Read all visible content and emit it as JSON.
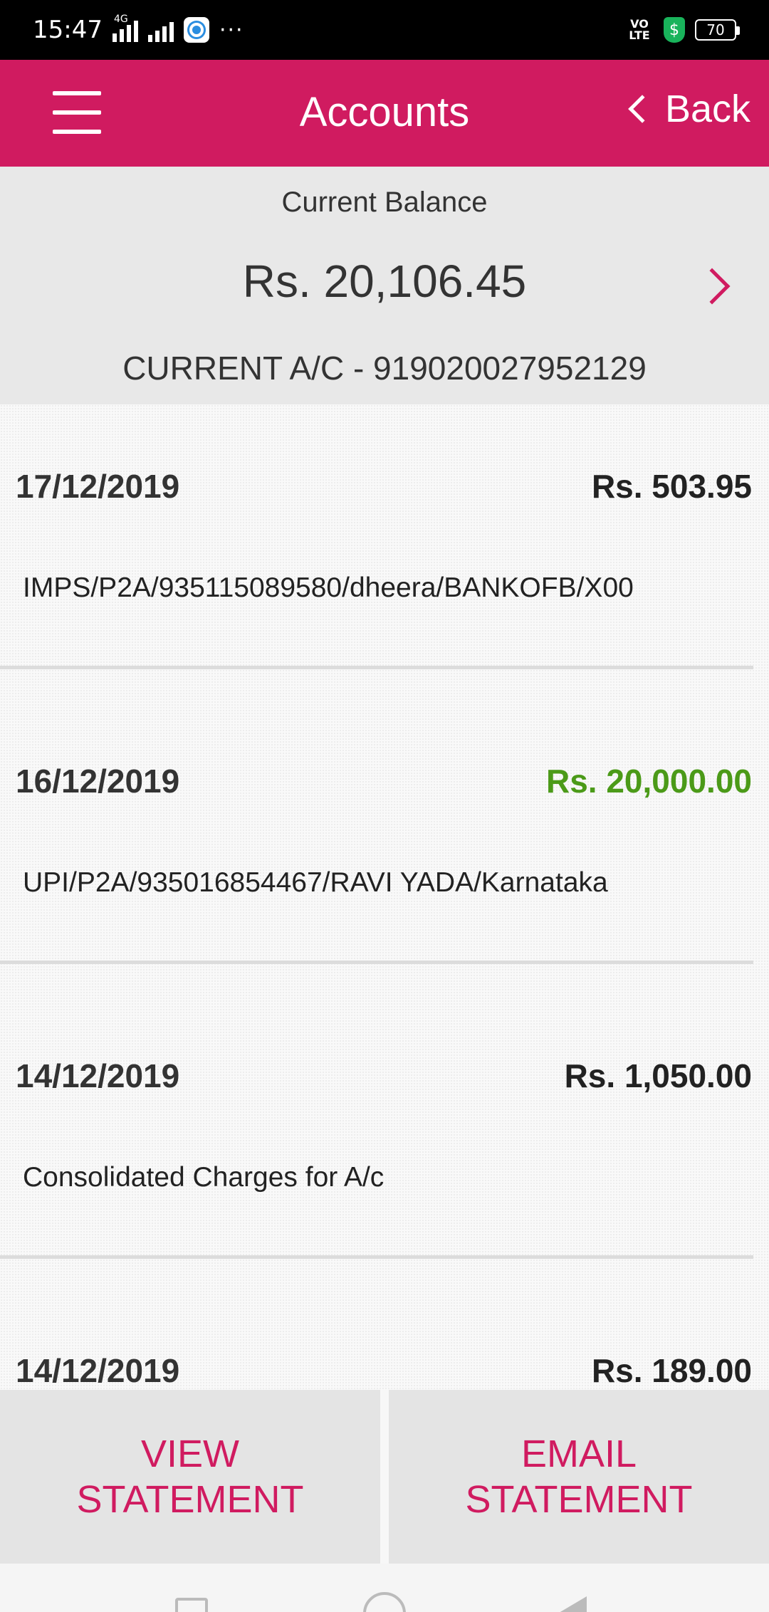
{
  "status_bar": {
    "time": "15:47",
    "network": "4G",
    "more": "···",
    "volte": "VO LTE",
    "shield": "$",
    "battery": "70"
  },
  "header": {
    "title": "Accounts",
    "back_label": "Back"
  },
  "balance": {
    "label": "Current Balance",
    "amount": "Rs. 20,106.45",
    "account": "CURRENT A/C - 919020027952129"
  },
  "transactions": [
    {
      "date": "17/12/2019",
      "amount": "Rs. 503.95",
      "type": "debit",
      "description": "IMPS/P2A/935115089580/dheera/BANKOFB/X00"
    },
    {
      "date": "16/12/2019",
      "amount": "Rs. 20,000.00",
      "type": "credit",
      "description": "UPI/P2A/935016854467/RAVI YADA/Karnataka"
    },
    {
      "date": "14/12/2019",
      "amount": "Rs. 1,050.00",
      "type": "debit",
      "description": "Consolidated Charges for A/c"
    },
    {
      "date": "14/12/2019",
      "amount": "Rs. 189.00",
      "type": "debit",
      "description": ""
    }
  ],
  "actions": {
    "view_line1": "VIEW",
    "view_line2": "STATEMENT",
    "email_line1": "EMAIL",
    "email_line2": "STATEMENT"
  },
  "colors": {
    "brand": "#d01b60",
    "credit": "#4b9a18"
  }
}
